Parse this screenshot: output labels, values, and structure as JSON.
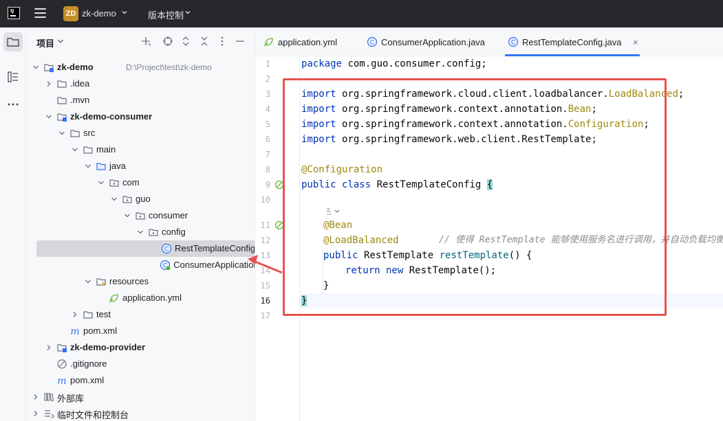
{
  "titlebar": {
    "logo_text": "IJ",
    "project_badge": "ZD",
    "project_name": "zk-demo",
    "vcs_label": "版本控制"
  },
  "project_panel": {
    "title": "项目",
    "tree": [
      {
        "label": "zk-demo",
        "hint": "D:\\Project\\test\\zk-demo",
        "bold": true,
        "icon": "module-folder-icon"
      },
      {
        "label": ".idea",
        "icon": "folder-icon"
      },
      {
        "label": ".mvn",
        "icon": "folder-icon"
      },
      {
        "label": "zk-demo-consumer",
        "bold": true,
        "icon": "module-folder-icon"
      },
      {
        "label": "src",
        "icon": "folder-icon"
      },
      {
        "label": "main",
        "icon": "folder-icon"
      },
      {
        "label": "java",
        "icon": "source-folder-icon"
      },
      {
        "label": "com",
        "icon": "package-icon"
      },
      {
        "label": "guo",
        "icon": "package-icon"
      },
      {
        "label": "consumer",
        "icon": "package-icon"
      },
      {
        "label": "config",
        "icon": "package-icon"
      },
      {
        "label": "RestTemplateConfig",
        "icon": "class-icon",
        "selected": true
      },
      {
        "label": "ConsumerApplication",
        "icon": "spring-class-icon"
      },
      {
        "label": "resources",
        "icon": "resources-folder-icon"
      },
      {
        "label": "application.yml",
        "icon": "spring-yml-icon"
      },
      {
        "label": "test",
        "icon": "folder-icon"
      },
      {
        "label": "pom.xml",
        "icon": "maven-icon"
      },
      {
        "label": "zk-demo-provider",
        "bold": true,
        "icon": "module-folder-icon"
      },
      {
        "label": ".gitignore",
        "icon": "ignore-file-icon"
      },
      {
        "label": "pom.xml",
        "icon": "maven-icon"
      },
      {
        "label": "外部库",
        "icon": "library-icon"
      },
      {
        "label": "临时文件和控制台",
        "icon": "scratches-icon"
      }
    ]
  },
  "tabs": [
    {
      "label": "application.yml",
      "icon": "spring-yml-icon"
    },
    {
      "label": "ConsumerApplication.java",
      "icon": "class-icon"
    },
    {
      "label": "RestTemplateConfig.java",
      "icon": "class-icon",
      "active": true,
      "close": "×"
    }
  ],
  "editor": {
    "line_numbers": [
      "1",
      "2",
      "3",
      "4",
      "5",
      "6",
      "7",
      "8",
      "9",
      "10",
      "11",
      "12",
      "13",
      "14",
      "15",
      "16",
      "17"
    ],
    "current_line": "16",
    "lines": {
      "l1_kw": "package",
      "l1_rest": " com.guo.consumer.config;",
      "import_kw": "import",
      "l3_pre": " org.springframework.cloud.client.loadbalancer.",
      "l3_ann": "LoadBalanced",
      "l4_pre": " org.springframework.context.annotation.",
      "l4_ann": "Bean",
      "l5_pre": " org.springframework.context.annotation.",
      "l5_ann": "Configuration",
      "l6_pre": " org.springframework.web.client.RestTemplate",
      "semi": ";",
      "l8": "@Configuration",
      "l9_kw": "public class",
      "l9_name": " RestTemplateConfig ",
      "open_brace": "{",
      "l11": "@Bean",
      "l12_ann": "@LoadBalanced",
      "l12_comment": "// 使得 RestTemplate 能够使用服务名进行调用，并自动负载均衡",
      "l13_kw": "public",
      "l13_type": " RestTemplate ",
      "l13_meth": "restTemplate",
      "l13_rest": "() {",
      "l14_kw1": "return",
      "l14_kw2": " new",
      "l14_rest": " RestTemplate();",
      "l15": "}",
      "close_brace": "}"
    }
  },
  "colors": {
    "accent": "#3574f0",
    "annotation_box": "#e8524f",
    "keyword": "#0033b3",
    "annotation": "#9e880d"
  }
}
